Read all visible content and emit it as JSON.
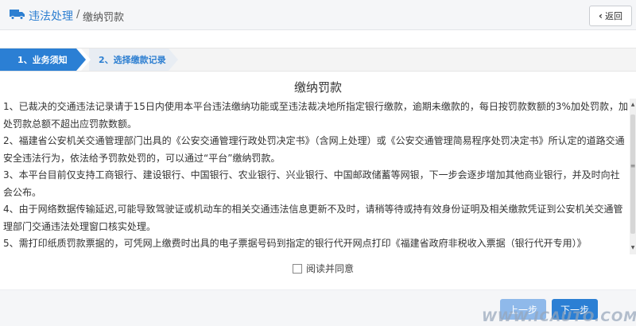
{
  "header": {
    "breadcrumb_main": "违法处理",
    "breadcrumb_sep": "/",
    "breadcrumb_current": "缴纳罚款",
    "back_label": "返回"
  },
  "steps": [
    {
      "label": "1、业务须知",
      "active": true
    },
    {
      "label": "2、选择缴款记录",
      "active": false
    }
  ],
  "notice": {
    "title": "缴纳罚款",
    "paragraphs": [
      "1、已裁决的交通违法记录请于15日内使用本平台违法缴纳功能或至违法裁决地所指定银行缴款，逾期未缴款的，每日按罚款数额的3%加处罚款，加处罚款总额不超出应罚款数额。",
      "2、福建省公安机关交通管理部门出具的《公安交通管理行政处罚决定书》（含网上处理）或《公安交通管理简易程序处罚决定书》所认定的道路交通安全违法行为，依法给予罚款处罚的，可以通过“平台”缴纳罚款。",
      "3、本平台目前仅支持工商银行、建设银行、中国银行、农业银行、兴业银行、中国邮政储蓄等网银，下一步会逐步增加其他商业银行，并及时向社会公布。",
      "4、由于网络数据传输延迟,可能导致驾驶证或机动车的相关交通违法信息更新不及时，请稍等待或持有效身份证明及相关缴款凭证到公安机关交通管理部门交通违法处理窗口核实处理。",
      "5、需打印纸质罚款票据的，可凭网上缴费时出具的电子票据号码到指定的银行代开网点打印《福建省政府非税收入票据（银行代开专用）》"
    ]
  },
  "agree": {
    "label": "阅读并同意",
    "checked": false
  },
  "footer": {
    "prev_label": "上一步",
    "next_label": "下一步",
    "watermark": "WWW.ICAUTO.COM.CN"
  },
  "colors": {
    "accent": "#2b7fd4",
    "link": "#2d7fd1",
    "prev_disabled": "#8fb9ea"
  }
}
